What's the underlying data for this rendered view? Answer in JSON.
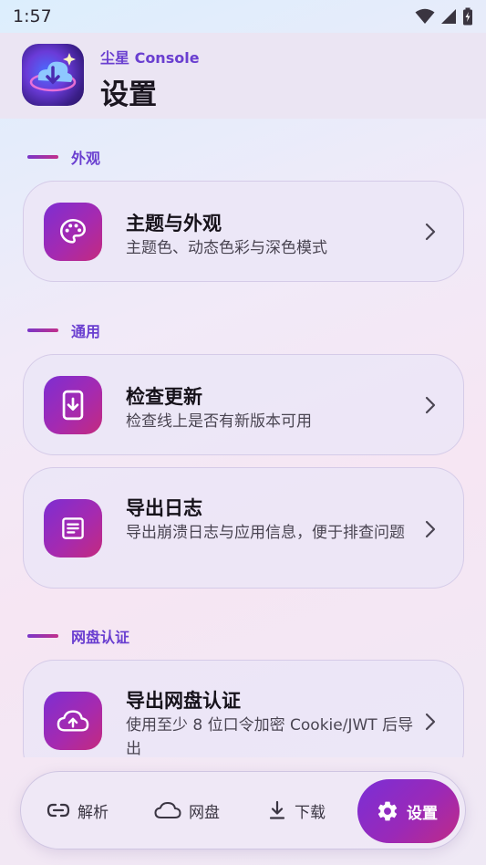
{
  "status_bar": {
    "time": "1:57"
  },
  "header": {
    "subtitle": "尘星 Console",
    "title": "设置"
  },
  "sections": {
    "appearance": {
      "label": "外观",
      "items": [
        {
          "title": "主题与外观",
          "desc": "主题色、动态色彩与深色模式",
          "icon": "palette-icon"
        }
      ]
    },
    "general": {
      "label": "通用",
      "items": [
        {
          "title": "检查更新",
          "desc": "检查线上是否有新版本可用",
          "icon": "phone-download-icon"
        },
        {
          "title": "导出日志",
          "desc": "导出崩溃日志与应用信息，便于排查问题",
          "icon": "document-icon"
        }
      ]
    },
    "cloud_auth": {
      "label": "网盘认证",
      "items": [
        {
          "title": "导出网盘认证",
          "desc": "使用至少 8 位口令加密 Cookie/JWT 后导出",
          "icon": "cloud-upload-icon"
        }
      ]
    }
  },
  "bottom_nav": {
    "items": [
      {
        "label": "解析",
        "icon": "link-icon"
      },
      {
        "label": "网盘",
        "icon": "cloud-icon"
      },
      {
        "label": "下载",
        "icon": "download-icon"
      },
      {
        "label": "设置",
        "icon": "gear-icon",
        "active": true
      }
    ]
  },
  "colors": {
    "accent": "#6a3fd0",
    "gradient_start": "#7d2ed2",
    "gradient_end": "#c42a7e"
  }
}
